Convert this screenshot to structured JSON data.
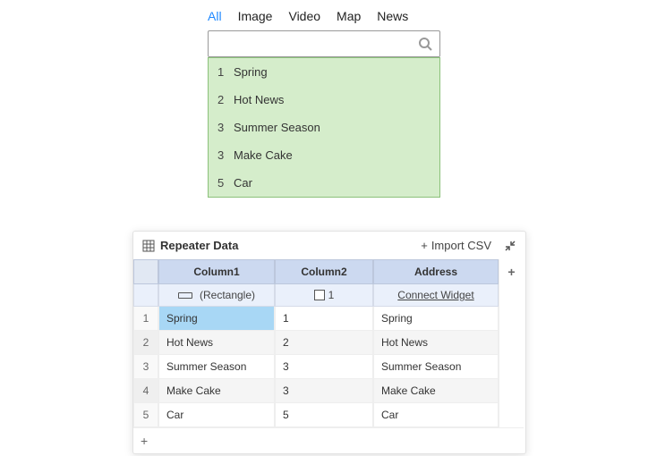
{
  "tabs": [
    "All",
    "Image",
    "Video",
    "Map",
    "News"
  ],
  "active_tab": "All",
  "search": {
    "value": "",
    "placeholder": ""
  },
  "suggestions": [
    {
      "n": "1",
      "label": "Spring"
    },
    {
      "n": "2",
      "label": "Hot News"
    },
    {
      "n": "3",
      "label": "Summer Season"
    },
    {
      "n": "3",
      "label": "Make Cake"
    },
    {
      "n": "5",
      "label": "Car"
    }
  ],
  "panel": {
    "title": "Repeater Data",
    "import_label": "Import CSV",
    "plus": "+",
    "headers": {
      "col1": "Column1",
      "col2": "Column2",
      "col3": "Address"
    },
    "subrow": {
      "col1": "(Rectangle)",
      "col2": "1",
      "col3": "Connect Widget"
    },
    "rows": [
      {
        "n": "1",
        "c1": "Spring",
        "c2": "1",
        "c3": "Spring"
      },
      {
        "n": "2",
        "c1": "Hot News",
        "c2": "2",
        "c3": "Hot News"
      },
      {
        "n": "3",
        "c1": "Summer Season",
        "c2": "3",
        "c3": "Summer Season"
      },
      {
        "n": "4",
        "c1": "Make Cake",
        "c2": "3",
        "c3": "Make Cake"
      },
      {
        "n": "5",
        "c1": "Car",
        "c2": "5",
        "c3": "Car"
      }
    ]
  }
}
